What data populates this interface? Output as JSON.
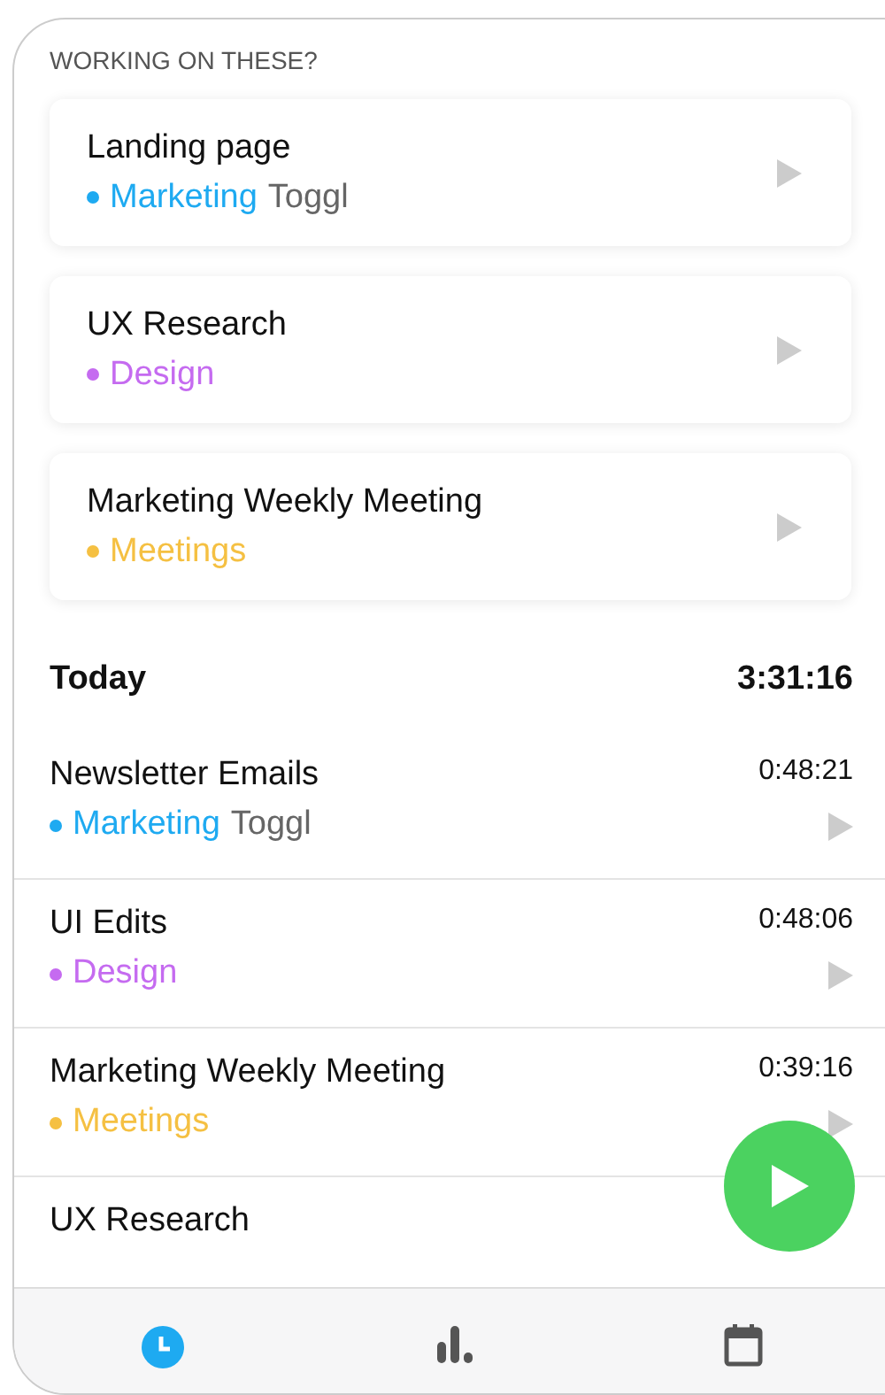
{
  "suggestions": {
    "heading": "WORKING ON THESE?",
    "items": [
      {
        "title": "Landing page",
        "project": "Marketing",
        "color": "#1eaaf1",
        "client": "Toggl"
      },
      {
        "title": "UX Research",
        "project": "Design",
        "color": "#c56bf0"
      },
      {
        "title": "Marketing Weekly Meeting",
        "project": "Meetings",
        "color": "#f5c042"
      }
    ]
  },
  "today": {
    "label": "Today",
    "total": "3:31:16",
    "entries": [
      {
        "title": "Newsletter Emails",
        "project": "Marketing",
        "color": "#1eaaf1",
        "client": "Toggl",
        "duration": "0:48:21"
      },
      {
        "title": "UI Edits",
        "project": "Design",
        "color": "#c56bf0",
        "duration": "0:48:06"
      },
      {
        "title": "Marketing Weekly Meeting",
        "project": "Meetings",
        "color": "#f5c042",
        "duration": "0:39:16"
      },
      {
        "title": "UX Research"
      }
    ]
  },
  "tabs": [
    {
      "kind": "timer",
      "selected": true
    },
    {
      "kind": "reports",
      "selected": false
    },
    {
      "kind": "calendar",
      "selected": false
    }
  ]
}
